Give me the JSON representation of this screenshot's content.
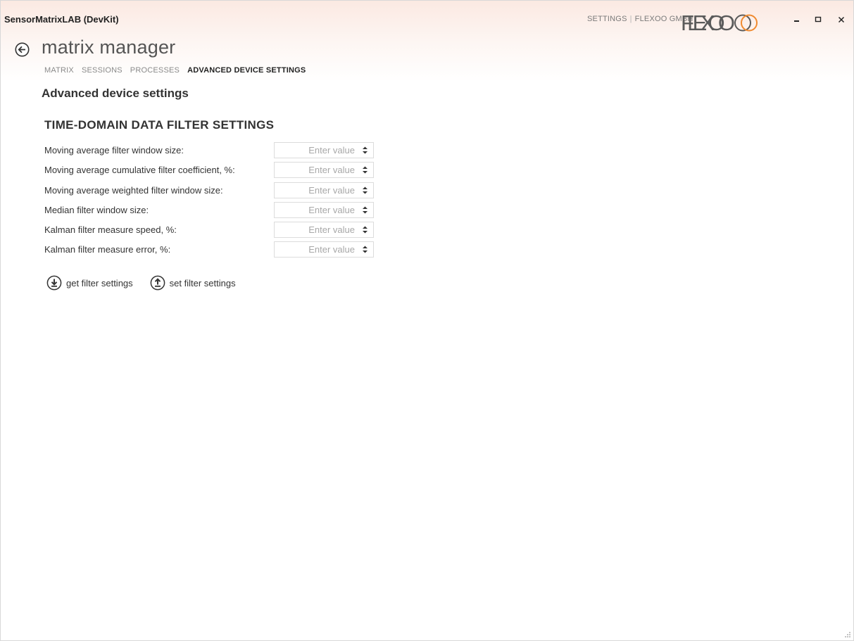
{
  "app": {
    "title": "SensorMatrixLAB (DevKit)",
    "links": [
      "SETTINGS",
      "FLEXOO GMBH"
    ],
    "logo_text": "FLEXOO",
    "accent": "#f08a2f",
    "window_controls": [
      "minimize-icon",
      "maximize-icon",
      "close-icon"
    ]
  },
  "header": {
    "back_icon": "back-arrow-icon",
    "title": "matrix manager",
    "tabs": [
      {
        "label": "MATRIX",
        "active": false
      },
      {
        "label": "SESSIONS",
        "active": false
      },
      {
        "label": "PROCESSES",
        "active": false
      },
      {
        "label": "ADVANCED DEVICE SETTINGS",
        "active": true
      }
    ]
  },
  "main": {
    "section_title": "Advanced device settings",
    "group_title": "TIME-DOMAIN DATA FILTER SETTINGS",
    "fields": [
      {
        "label": "Moving average filter window size:",
        "placeholder": "Enter value",
        "value": ""
      },
      {
        "label": "Moving average cumulative filter coefficient, %:",
        "placeholder": "Enter value",
        "value": ""
      },
      {
        "label": "Moving average weighted filter window size:",
        "placeholder": "Enter value",
        "value": ""
      },
      {
        "label": "Median filter window size:",
        "placeholder": "Enter value",
        "value": ""
      },
      {
        "label": "Kalman filter measure speed, %:",
        "placeholder": "Enter value",
        "value": ""
      },
      {
        "label": "Kalman filter measure error, %:",
        "placeholder": "Enter value",
        "value": ""
      }
    ],
    "actions": {
      "get_label": "get filter settings",
      "get_icon": "download-icon",
      "set_label": "set filter settings",
      "set_icon": "upload-icon"
    }
  }
}
